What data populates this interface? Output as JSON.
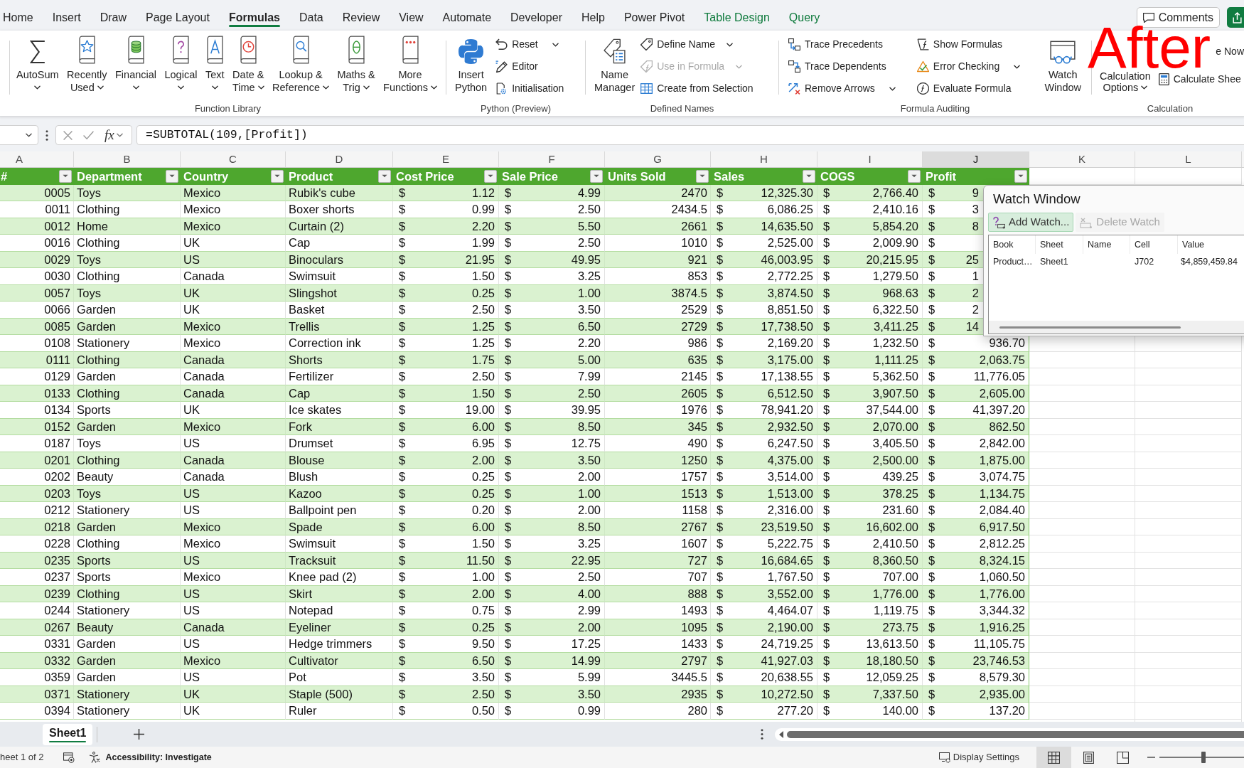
{
  "ribbon_tabs": [
    {
      "label": "Home",
      "kind": "standard",
      "selected": false
    },
    {
      "label": "Insert",
      "kind": "standard",
      "selected": false
    },
    {
      "label": "Draw",
      "kind": "standard",
      "selected": false
    },
    {
      "label": "Page Layout",
      "kind": "standard",
      "selected": false
    },
    {
      "label": "Formulas",
      "kind": "standard",
      "selected": true
    },
    {
      "label": "Data",
      "kind": "standard",
      "selected": false
    },
    {
      "label": "Review",
      "kind": "standard",
      "selected": false
    },
    {
      "label": "View",
      "kind": "standard",
      "selected": false
    },
    {
      "label": "Automate",
      "kind": "standard",
      "selected": false
    },
    {
      "label": "Developer",
      "kind": "standard",
      "selected": false
    },
    {
      "label": "Help",
      "kind": "standard",
      "selected": false
    },
    {
      "label": "Power Pivot",
      "kind": "standard",
      "selected": false
    },
    {
      "label": "Table Design",
      "kind": "contextual",
      "selected": false
    },
    {
      "label": "Query",
      "kind": "contextual",
      "selected": false
    }
  ],
  "comments_button": "Comments",
  "annotation": "After",
  "function_library": {
    "label": "Function Library",
    "buttons": [
      {
        "label": "AutoSum",
        "dropdown": true
      },
      {
        "label": "Recently Used",
        "dropdown": true
      },
      {
        "label": "Financial",
        "dropdown": true
      },
      {
        "label": "Logical",
        "dropdown": true
      },
      {
        "label": "Text",
        "dropdown": true
      },
      {
        "label": "Date & Time",
        "dropdown": true
      },
      {
        "label": "Lookup & Reference",
        "dropdown": true
      },
      {
        "label": "Maths & Trig",
        "dropdown": true
      },
      {
        "label": "More Functions",
        "dropdown": true
      }
    ]
  },
  "python": {
    "label": "Python (Preview)",
    "insert_button": "Insert Python",
    "commands": [
      {
        "label": "Reset",
        "dropdown": true
      },
      {
        "label": "Editor",
        "dropdown": false
      },
      {
        "label": "Initialisation",
        "dropdown": false
      }
    ]
  },
  "defined_names": {
    "label": "Defined Names",
    "manager_button": "Name Manager",
    "commands": [
      {
        "label": "Define Name",
        "dropdown": true,
        "disabled": false
      },
      {
        "label": "Use in Formula",
        "dropdown": true,
        "disabled": true
      },
      {
        "label": "Create from Selection",
        "dropdown": false,
        "disabled": false
      }
    ]
  },
  "formula_auditing": {
    "label": "Formula Auditing",
    "commands": [
      {
        "label": "Trace Precedents",
        "dropdown": false
      },
      {
        "label": "Trace Dependents",
        "dropdown": false
      },
      {
        "label": "Remove Arrows",
        "dropdown": true
      },
      {
        "label": "Show Formulas",
        "dropdown": false
      },
      {
        "label": "Error Checking",
        "dropdown": true
      },
      {
        "label": "Evaluate Formula",
        "dropdown": false
      }
    ],
    "watch_button": "Watch Window"
  },
  "calculation": {
    "label": "Calculation",
    "options_button": {
      "label": "Calculation Options",
      "dropdown": true
    },
    "commands": [
      {
        "label": "e Now"
      },
      {
        "label": "Calculate Shee"
      }
    ]
  },
  "formula_bar": {
    "insert_function": "fx",
    "formula": "=SUBTOTAL(109,[Profit])"
  },
  "column_headers": [
    {
      "label": "A",
      "selected": false
    },
    {
      "label": "B",
      "selected": false
    },
    {
      "label": "C",
      "selected": false
    },
    {
      "label": "D",
      "selected": false
    },
    {
      "label": "E",
      "selected": false
    },
    {
      "label": "F",
      "selected": false
    },
    {
      "label": "G",
      "selected": false
    },
    {
      "label": "H",
      "selected": false
    },
    {
      "label": "I",
      "selected": false
    },
    {
      "label": "J",
      "selected": true
    },
    {
      "label": "K",
      "selected": false
    },
    {
      "label": "L",
      "selected": false
    }
  ],
  "table": {
    "columns": [
      {
        "label": "#",
        "kind": "id"
      },
      {
        "label": "Department",
        "kind": "text"
      },
      {
        "label": "Country",
        "kind": "text"
      },
      {
        "label": "Product",
        "kind": "text"
      },
      {
        "label": "Cost Price",
        "kind": "currency"
      },
      {
        "label": "Sale Price",
        "kind": "currency"
      },
      {
        "label": "Units Sold",
        "kind": "number"
      },
      {
        "label": "Sales",
        "kind": "currency"
      },
      {
        "label": "COGS",
        "kind": "currency"
      },
      {
        "label": "Profit",
        "kind": "currency"
      }
    ],
    "rows": [
      {
        "cells": [
          "0005",
          "Toys",
          "Mexico",
          "Rubik's cube",
          [
            "$",
            "1.12"
          ],
          [
            "$",
            "4.99"
          ],
          "2470",
          [
            "$",
            "12,325.30"
          ],
          [
            "$",
            "2,766.40"
          ],
          [
            "$",
            "9"
          ]
        ]
      },
      {
        "cells": [
          "0011",
          "Clothing",
          "Mexico",
          "Boxer shorts",
          [
            "$",
            "0.99"
          ],
          [
            "$",
            "2.50"
          ],
          "2434.5",
          [
            "$",
            "6,086.25"
          ],
          [
            "$",
            "2,410.16"
          ],
          [
            "$",
            "3"
          ]
        ]
      },
      {
        "cells": [
          "0012",
          "Home",
          "Mexico",
          "Curtain (2)",
          [
            "$",
            "2.20"
          ],
          [
            "$",
            "5.50"
          ],
          "2661",
          [
            "$",
            "14,635.50"
          ],
          [
            "$",
            "5,854.20"
          ],
          [
            "$",
            "8"
          ]
        ]
      },
      {
        "cells": [
          "0016",
          "Clothing",
          "UK",
          "Cap",
          [
            "$",
            "1.99"
          ],
          [
            "$",
            "2.50"
          ],
          "1010",
          [
            "$",
            "2,525.00"
          ],
          [
            "$",
            "2,009.90"
          ],
          [
            "$"
          ]
        ]
      },
      {
        "cells": [
          "0029",
          "Toys",
          "US",
          "Binoculars",
          [
            "$",
            "21.95"
          ],
          [
            "$",
            "49.95"
          ],
          "921",
          [
            "$",
            "46,003.95"
          ],
          [
            "$",
            "20,215.95"
          ],
          [
            "$",
            "25"
          ]
        ]
      },
      {
        "cells": [
          "0030",
          "Clothing",
          "Canada",
          "Swimsuit",
          [
            "$",
            "1.50"
          ],
          [
            "$",
            "3.25"
          ],
          "853",
          [
            "$",
            "2,772.25"
          ],
          [
            "$",
            "1,279.50"
          ],
          [
            "$",
            "1"
          ]
        ]
      },
      {
        "cells": [
          "0057",
          "Toys",
          "UK",
          "Slingshot",
          [
            "$",
            "0.25"
          ],
          [
            "$",
            "1.00"
          ],
          "3874.5",
          [
            "$",
            "3,874.50"
          ],
          [
            "$",
            "968.63"
          ],
          [
            "$",
            "2"
          ]
        ]
      },
      {
        "cells": [
          "0066",
          "Garden",
          "UK",
          "Basket",
          [
            "$",
            "2.50"
          ],
          [
            "$",
            "3.50"
          ],
          "2529",
          [
            "$",
            "8,851.50"
          ],
          [
            "$",
            "6,322.50"
          ],
          [
            "$",
            "2"
          ]
        ]
      },
      {
        "cells": [
          "0085",
          "Garden",
          "Mexico",
          "Trellis",
          [
            "$",
            "1.25"
          ],
          [
            "$",
            "6.50"
          ],
          "2729",
          [
            "$",
            "17,738.50"
          ],
          [
            "$",
            "3,411.25"
          ],
          [
            "$",
            "14"
          ]
        ]
      },
      {
        "cells": [
          "0108",
          "Stationery",
          "Mexico",
          "Correction ink",
          [
            "$",
            "1.25"
          ],
          [
            "$",
            "2.20"
          ],
          "986",
          [
            "$",
            "2,169.20"
          ],
          [
            "$",
            "1,232.50"
          ],
          [
            "$",
            "936.70"
          ]
        ]
      },
      {
        "cells": [
          "0111",
          "Clothing",
          "Canada",
          "Shorts",
          [
            "$",
            "1.75"
          ],
          [
            "$",
            "5.00"
          ],
          "635",
          [
            "$",
            "3,175.00"
          ],
          [
            "$",
            "1,111.25"
          ],
          [
            "$",
            "2,063.75"
          ]
        ]
      },
      {
        "cells": [
          "0129",
          "Garden",
          "Canada",
          "Fertilizer",
          [
            "$",
            "2.50"
          ],
          [
            "$",
            "7.99"
          ],
          "2145",
          [
            "$",
            "17,138.55"
          ],
          [
            "$",
            "5,362.50"
          ],
          [
            "$",
            "11,776.05"
          ]
        ]
      },
      {
        "cells": [
          "0133",
          "Clothing",
          "Canada",
          "Cap",
          [
            "$",
            "1.50"
          ],
          [
            "$",
            "2.50"
          ],
          "2605",
          [
            "$",
            "6,512.50"
          ],
          [
            "$",
            "3,907.50"
          ],
          [
            "$",
            "2,605.00"
          ]
        ]
      },
      {
        "cells": [
          "0134",
          "Sports",
          "UK",
          "Ice skates",
          [
            "$",
            "19.00"
          ],
          [
            "$",
            "39.95"
          ],
          "1976",
          [
            "$",
            "78,941.20"
          ],
          [
            "$",
            "37,544.00"
          ],
          [
            "$",
            "41,397.20"
          ]
        ]
      },
      {
        "cells": [
          "0152",
          "Garden",
          "Mexico",
          "Fork",
          [
            "$",
            "6.00"
          ],
          [
            "$",
            "8.50"
          ],
          "345",
          [
            "$",
            "2,932.50"
          ],
          [
            "$",
            "2,070.00"
          ],
          [
            "$",
            "862.50"
          ]
        ]
      },
      {
        "cells": [
          "0187",
          "Toys",
          "US",
          "Drumset",
          [
            "$",
            "6.95"
          ],
          [
            "$",
            "12.75"
          ],
          "490",
          [
            "$",
            "6,247.50"
          ],
          [
            "$",
            "3,405.50"
          ],
          [
            "$",
            "2,842.00"
          ]
        ]
      },
      {
        "cells": [
          "0201",
          "Clothing",
          "Canada",
          "Blouse",
          [
            "$",
            "2.00"
          ],
          [
            "$",
            "3.50"
          ],
          "1250",
          [
            "$",
            "4,375.00"
          ],
          [
            "$",
            "2,500.00"
          ],
          [
            "$",
            "1,875.00"
          ]
        ]
      },
      {
        "cells": [
          "0202",
          "Beauty",
          "Canada",
          "Blush",
          [
            "$",
            "0.25"
          ],
          [
            "$",
            "2.00"
          ],
          "1757",
          [
            "$",
            "3,514.00"
          ],
          [
            "$",
            "439.25"
          ],
          [
            "$",
            "3,074.75"
          ]
        ]
      },
      {
        "cells": [
          "0203",
          "Toys",
          "US",
          "Kazoo",
          [
            "$",
            "0.25"
          ],
          [
            "$",
            "1.00"
          ],
          "1513",
          [
            "$",
            "1,513.00"
          ],
          [
            "$",
            "378.25"
          ],
          [
            "$",
            "1,134.75"
          ]
        ]
      },
      {
        "cells": [
          "0212",
          "Stationery",
          "US",
          "Ballpoint pen",
          [
            "$",
            "0.20"
          ],
          [
            "$",
            "2.00"
          ],
          "1158",
          [
            "$",
            "2,316.00"
          ],
          [
            "$",
            "231.60"
          ],
          [
            "$",
            "2,084.40"
          ]
        ]
      },
      {
        "cells": [
          "0218",
          "Garden",
          "Mexico",
          "Spade",
          [
            "$",
            "6.00"
          ],
          [
            "$",
            "8.50"
          ],
          "2767",
          [
            "$",
            "23,519.50"
          ],
          [
            "$",
            "16,602.00"
          ],
          [
            "$",
            "6,917.50"
          ]
        ]
      },
      {
        "cells": [
          "0228",
          "Clothing",
          "Mexico",
          "Swimsuit",
          [
            "$",
            "1.50"
          ],
          [
            "$",
            "3.25"
          ],
          "1607",
          [
            "$",
            "5,222.75"
          ],
          [
            "$",
            "2,410.50"
          ],
          [
            "$",
            "2,812.25"
          ]
        ]
      },
      {
        "cells": [
          "0235",
          "Sports",
          "US",
          "Tracksuit",
          [
            "$",
            "11.50"
          ],
          [
            "$",
            "22.95"
          ],
          "727",
          [
            "$",
            "16,684.65"
          ],
          [
            "$",
            "8,360.50"
          ],
          [
            "$",
            "8,324.15"
          ]
        ]
      },
      {
        "cells": [
          "0237",
          "Sports",
          "Mexico",
          "Knee pad (2)",
          [
            "$",
            "1.00"
          ],
          [
            "$",
            "2.50"
          ],
          "707",
          [
            "$",
            "1,767.50"
          ],
          [
            "$",
            "707.00"
          ],
          [
            "$",
            "1,060.50"
          ]
        ]
      },
      {
        "cells": [
          "0239",
          "Clothing",
          "US",
          "Skirt",
          [
            "$",
            "2.00"
          ],
          [
            "$",
            "4.00"
          ],
          "888",
          [
            "$",
            "3,552.00"
          ],
          [
            "$",
            "1,776.00"
          ],
          [
            "$",
            "1,776.00"
          ]
        ]
      },
      {
        "cells": [
          "0244",
          "Stationery",
          "US",
          "Notepad",
          [
            "$",
            "0.75"
          ],
          [
            "$",
            "2.99"
          ],
          "1493",
          [
            "$",
            "4,464.07"
          ],
          [
            "$",
            "1,119.75"
          ],
          [
            "$",
            "3,344.32"
          ]
        ]
      },
      {
        "cells": [
          "0267",
          "Beauty",
          "Canada",
          "Eyeliner",
          [
            "$",
            "0.25"
          ],
          [
            "$",
            "2.00"
          ],
          "1095",
          [
            "$",
            "2,190.00"
          ],
          [
            "$",
            "273.75"
          ],
          [
            "$",
            "1,916.25"
          ]
        ]
      },
      {
        "cells": [
          "0331",
          "Garden",
          "US",
          "Hedge trimmers",
          [
            "$",
            "9.50"
          ],
          [
            "$",
            "17.25"
          ],
          "1433",
          [
            "$",
            "24,719.25"
          ],
          [
            "$",
            "13,613.50"
          ],
          [
            "$",
            "11,105.75"
          ]
        ]
      },
      {
        "cells": [
          "0332",
          "Garden",
          "Mexico",
          "Cultivator",
          [
            "$",
            "6.50"
          ],
          [
            "$",
            "14.99"
          ],
          "2797",
          [
            "$",
            "41,927.03"
          ],
          [
            "$",
            "18,180.50"
          ],
          [
            "$",
            "23,746.53"
          ]
        ]
      },
      {
        "cells": [
          "0359",
          "Garden",
          "US",
          "Pot",
          [
            "$",
            "3.50"
          ],
          [
            "$",
            "5.99"
          ],
          "3445.5",
          [
            "$",
            "20,638.55"
          ],
          [
            "$",
            "12,059.25"
          ],
          [
            "$",
            "8,579.30"
          ]
        ]
      },
      {
        "cells": [
          "0371",
          "Stationery",
          "UK",
          "Staple (500)",
          [
            "$",
            "2.50"
          ],
          [
            "$",
            "3.50"
          ],
          "2935",
          [
            "$",
            "10,272.50"
          ],
          [
            "$",
            "7,337.50"
          ],
          [
            "$",
            "2,935.00"
          ]
        ]
      },
      {
        "cells": [
          "0394",
          "Stationery",
          "UK",
          "Ruler",
          [
            "$",
            "0.50"
          ],
          [
            "$",
            "0.99"
          ],
          "280",
          [
            "$",
            "277.20"
          ],
          [
            "$",
            "140.00"
          ],
          [
            "$",
            "137.20"
          ]
        ]
      }
    ]
  },
  "watch_window": {
    "title": "Watch Window",
    "buttons": [
      {
        "label": "Add Watch...",
        "highlighted": true,
        "disabled": false
      },
      {
        "label": "Delete Watch",
        "highlighted": false,
        "disabled": true
      }
    ],
    "columns": [
      "Book",
      "Sheet",
      "Name",
      "Cell",
      "Value"
    ],
    "rows": [
      {
        "book": "Product…",
        "sheet": "Sheet1",
        "cell": "J702",
        "value": "$4,859,459.84"
      }
    ]
  },
  "sheet_tabs": [
    {
      "label": "Sheet1",
      "selected": true
    }
  ],
  "status_bar": {
    "sheet_position": "heet 1 of 2",
    "accessibility": "Accessibility: Investigate",
    "display_settings": "Display Settings",
    "views": [
      {
        "kind": "normal",
        "selected": true
      },
      {
        "kind": "page_layout",
        "selected": false
      },
      {
        "kind": "page_break",
        "selected": false
      }
    ],
    "zoom": {
      "level": 0.52
    }
  }
}
